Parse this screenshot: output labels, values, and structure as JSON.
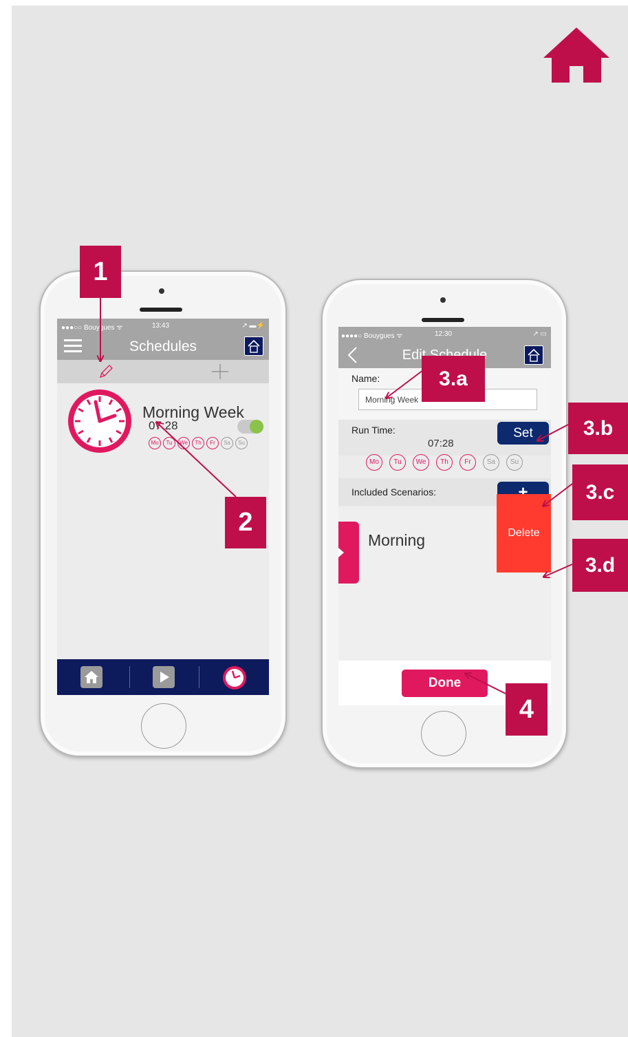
{
  "colors": {
    "accent": "#be0f4b",
    "pink": "#e0195f",
    "navy": "#0d1a5c",
    "delete_red": "#ff3b30",
    "toggle_green": "#8bc34a"
  },
  "left_phone": {
    "status": {
      "carrier": "●●●○○ Bouygues ᯤ",
      "time": "13:43",
      "right": "↗ ▬⚡"
    },
    "nav": {
      "menu_icon": "hamburger-icon",
      "title": "Schedules",
      "home_icon": "house-icon"
    },
    "toolbar": {
      "edit_icon": "pencil-icon",
      "add_icon": "plus-icon"
    },
    "schedule": {
      "icon": "clock-icon",
      "name": "Morning Week",
      "time": "07:28",
      "enabled": true,
      "days": [
        {
          "label": "Mo",
          "active": true
        },
        {
          "label": "Tu",
          "active": true
        },
        {
          "label": "We",
          "active": true
        },
        {
          "label": "Th",
          "active": true
        },
        {
          "label": "Fr",
          "active": true
        },
        {
          "label": "Sa",
          "active": false
        },
        {
          "label": "Su",
          "active": false
        }
      ]
    },
    "tabbar": [
      {
        "icon": "home-icon"
      },
      {
        "icon": "play-icon"
      },
      {
        "icon": "clock-icon"
      }
    ]
  },
  "right_phone": {
    "status": {
      "carrier": "●●●●○ Bouygues ᯤ",
      "time": "12:30",
      "right": "↗ ▭"
    },
    "nav": {
      "title": "Edit Schedule",
      "back_icon": "chevron-left-icon",
      "home_icon": "house-icon"
    },
    "name_label": "Name:",
    "name_value": "Morning Week",
    "run_time_label": "Run Time:",
    "run_time": "07:28",
    "set_label": "Set",
    "days": [
      {
        "label": "Mo",
        "active": true
      },
      {
        "label": "Tu",
        "active": true
      },
      {
        "label": "We",
        "active": true
      },
      {
        "label": "Th",
        "active": true
      },
      {
        "label": "Fr",
        "active": true
      },
      {
        "label": "Sa",
        "active": false
      },
      {
        "label": "Su",
        "active": false
      }
    ],
    "included_label": "Included Scenarios:",
    "add_label": "+",
    "scenario_name": "Morning",
    "delete_label": "Delete",
    "done_label": "Done"
  },
  "callouts": {
    "c1": "1",
    "c2": "2",
    "c3a": "3.a",
    "c3b": "3.b",
    "c3c": "3.c",
    "c3d": "3.d",
    "c4": "4"
  }
}
